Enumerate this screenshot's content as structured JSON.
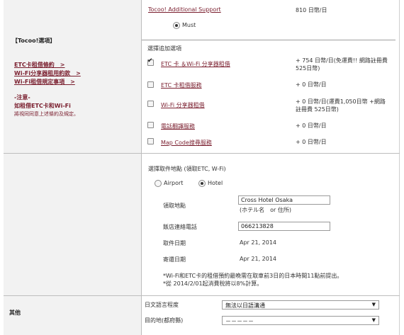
{
  "support": {
    "title": "Tocoo! Additional Support",
    "price": "810 日幣/日",
    "must_label": "Must"
  },
  "sidebar": {
    "section_title": "【Tocoo!選項】",
    "links": [
      "ETC卡租借條約　>",
      "Wi-Fi分享器租用約款　>",
      "Wi-Fi租借規定事項　>"
    ],
    "note_title": "-注意-",
    "note_line1": "如租借ETC卡和Wi-Fi",
    "note_line2": "將視同同意上述條約及規定。",
    "other_label": "其他"
  },
  "options": {
    "header": "選擇追加選項",
    "items": [
      {
        "label": "ETC 卡 ＆Wi-Fi 分享器租借",
        "price_line1": "+ 754 日幣/日(免運費!! 網路註冊費",
        "price_line2": "525日幣)",
        "checked": true
      },
      {
        "label": "ETC 卡租借服務",
        "price_line1": "+ 0 日幣/日",
        "price_line2": "",
        "checked": false
      },
      {
        "label": "Wi-Fi 分享器租借",
        "price_line1": "+ 0 日幣/日(運費1,050日幣 +網路",
        "price_line2": "註冊費 525日幣)",
        "checked": false
      },
      {
        "label": "電話翻譯服務",
        "price_line1": "+ 0 日幣/日",
        "price_line2": "",
        "checked": false
      },
      {
        "label": "Map Code搜尋服務",
        "price_line1": "+ 0 日幣/日",
        "price_line2": "",
        "checked": false
      }
    ]
  },
  "pickup": {
    "header": "選擇取件地點 (領取ETC, W-Fi)",
    "radio_airport": "Airport",
    "radio_hotel": "Hotel",
    "selected": "Hotel",
    "location_label": "領取地點",
    "location_value": "Cross Hotel Osaka",
    "location_hint": "(ホテル名　or 住所)",
    "phone_label": "飯店連絡電話",
    "phone_value": "066213828",
    "pickup_date_label": "取件日期",
    "pickup_date_value": "Apr 21, 2014",
    "return_date_label": "寄還日期",
    "return_date_value": "Apr 21, 2014",
    "note1": "*Wi-Fi和ETC卡的租借預約最晚需在取車前3日的日本時間11點前提出。",
    "note2": "*從 2014/2/01起消費稅將以8%計算。"
  },
  "other": {
    "japanese_label": "日文語言程度",
    "japanese_value": "無法以日語溝通",
    "destination_label": "目的地(都府縣)",
    "destination_value": "－－－－－"
  },
  "icons": {
    "checkmark": "check-icon",
    "dropdown": "chevron-down-icon"
  }
}
